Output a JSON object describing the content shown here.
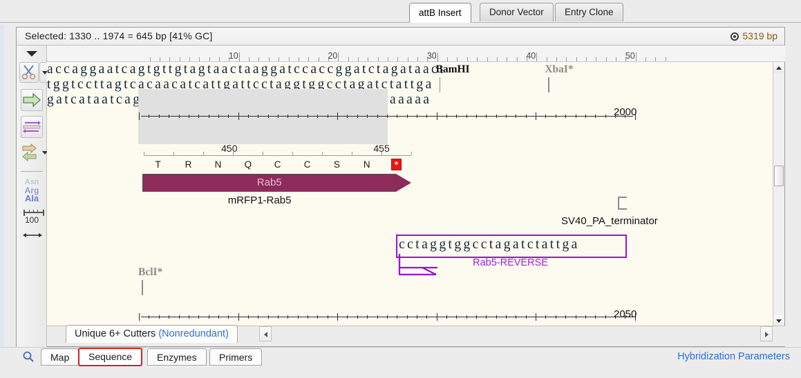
{
  "window": {
    "top_tabs": [
      {
        "label": "attB Insert",
        "active": true
      },
      {
        "label": "Donor Vector",
        "active": false
      },
      {
        "label": "Entry Clone",
        "active": false
      }
    ],
    "info_bar": {
      "selection": "Selected:  1330 .. 1974  =  645 bp      [41% GC]",
      "total_bp": "5319 bp",
      "circle_icon": "circular-plasmid-icon"
    }
  },
  "left_toolbar": {
    "items": [
      {
        "name": "options-caret",
        "icon": "chevron-down-icon"
      },
      {
        "name": "cut-tool",
        "icon": "scissors-icon"
      },
      {
        "name": "cut-tool-dropdown",
        "icon": "chevron-down-icon"
      },
      {
        "name": "feature-tool",
        "icon": "green-arrow-icon"
      },
      {
        "name": "primer-tool",
        "icon": "primer-duplex-icon"
      },
      {
        "name": "translation-tool",
        "icon": "two-way-arrows-icon"
      },
      {
        "name": "translation-dropdown",
        "icon": "chevron-down-icon"
      }
    ],
    "amino_labels": [
      "Asn",
      "Arg",
      "Ala"
    ],
    "scale_label": "100",
    "scale_icon": "ruler-icon",
    "resize_icon": "double-arrow-icon"
  },
  "ruler": {
    "ticks": [
      "10",
      "20",
      "30",
      "40",
      "50"
    ],
    "minor_step": 1,
    "major_step": 10
  },
  "sequence": {
    "block1": {
      "top_strand": "accaggaatcagtgttgtagtaactaaggatccaccggatctagataact",
      "bottom_strand": "tggtccttagtcacaacatcattgattcctaggtggcctagatctattga",
      "selection_chars": 25,
      "position_label": "2000"
    },
    "block2": {
      "top_strand": "gatcataatcagccataccacatttgtagaggttttacttgctttaaaaa",
      "position_label": "2050"
    }
  },
  "enzymes": [
    {
      "name": "BamHI",
      "style": "strong",
      "char_index": 30
    },
    {
      "name": "XbaI*",
      "style": "dim",
      "char_index": 41
    },
    {
      "name": "BclI*",
      "style": "dim",
      "char_index": 0
    }
  ],
  "translation": {
    "residues": [
      "T",
      "R",
      "N",
      "Q",
      "C",
      "C",
      "S",
      "N"
    ],
    "stop_symbol": "*",
    "numbers": [
      "450",
      "455"
    ],
    "feature_name": "Rab5",
    "feature_sublabel": "mRFP1-Rab5",
    "feature_color": "#8e2b5a"
  },
  "primer": {
    "sequence": "cctaggtggcctagatctattga",
    "label": "Rab5-REVERSE",
    "color": "#9a12d6",
    "direction": "reverse"
  },
  "terminator": {
    "label": "SV40_PA_terminator",
    "icon": "open-bracket-icon"
  },
  "scrollbars": {
    "vertical": {
      "up_icon": "triangle-up-icon",
      "down_icon": "triangle-down-icon",
      "thumb": "scroll-thumb"
    },
    "horizontal": {
      "left_icon": "triangle-left-icon",
      "right_icon": "triangle-right-icon"
    }
  },
  "cutters_tab": {
    "label": "Unique 6+ Cutters",
    "suffix": "(Nonredundant)"
  },
  "bottom": {
    "search_icon": "magnifier-icon",
    "tabs": [
      {
        "label": "Map",
        "selected": false
      },
      {
        "label": "Sequence",
        "selected": true
      },
      {
        "label": "Enzymes",
        "selected": false
      },
      {
        "label": "Primers",
        "selected": false
      }
    ],
    "link": "Hybridization Parameters"
  },
  "colors": {
    "canvas_bg": "#fdfaf0",
    "selection_bg": "#e0e0e0",
    "feature": "#8e2b5a",
    "primer": "#9a12d6",
    "link": "#2f6fd0",
    "stop_codon": "#ef1414",
    "bp_text": "#8a5a12",
    "selected_tab_border": "#d62020"
  }
}
